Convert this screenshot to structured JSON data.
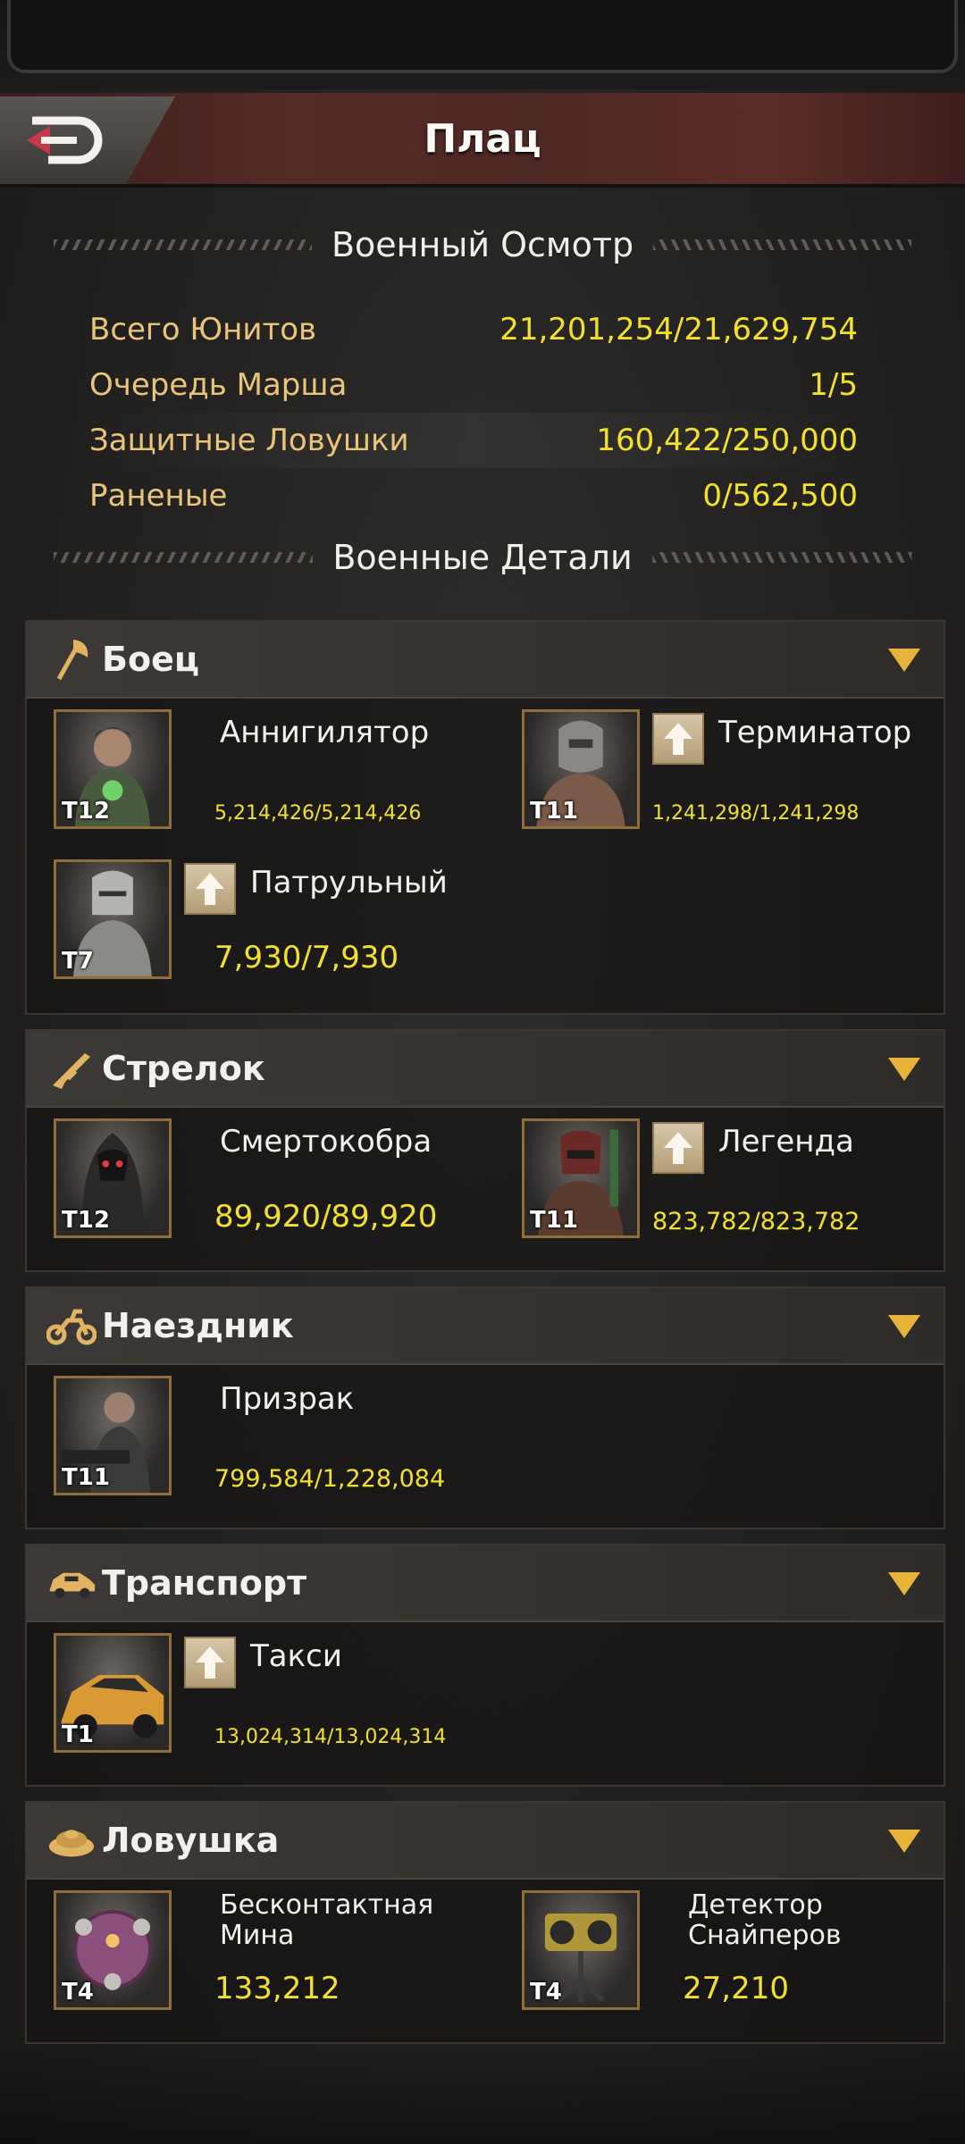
{
  "header": {
    "title": "Плац",
    "back_icon": "back-arrow-icon"
  },
  "inspection": {
    "title": "Военный Осмотр",
    "stats": [
      {
        "label": "Всего Юнитов",
        "value": "21,201,254/21,629,754"
      },
      {
        "label": "Очередь Марша",
        "value": "1/5"
      },
      {
        "label": "Защитные Ловушки",
        "value": "160,422/250,000"
      },
      {
        "label": "Раненые",
        "value": "0/562,500"
      }
    ]
  },
  "details": {
    "title": "Военные Детали"
  },
  "categories": [
    {
      "name": "Боец",
      "icon": "axe-icon",
      "units": [
        {
          "name": "Аннигилятор",
          "tier": "T12",
          "count": "5,214,426/5,214,426",
          "upgrade": false
        },
        {
          "name": "Терминатор",
          "tier": "T11",
          "count": "1,241,298/1,241,298",
          "upgrade": true
        },
        {
          "name": "Патрульный",
          "tier": "T7",
          "count": "7,930/7,930",
          "upgrade": true
        }
      ]
    },
    {
      "name": "Стрелок",
      "icon": "rifle-icon",
      "units": [
        {
          "name": "Смертокобра",
          "tier": "T12",
          "count": "89,920/89,920",
          "upgrade": false
        },
        {
          "name": "Легенда",
          "tier": "T11",
          "count": "823,782/823,782",
          "upgrade": true
        }
      ]
    },
    {
      "name": "Наездник",
      "icon": "motorcycle-icon",
      "units": [
        {
          "name": "Призрак",
          "tier": "T11",
          "count": "799,584/1,228,084",
          "upgrade": false
        }
      ]
    },
    {
      "name": "Транспорт",
      "icon": "car-icon",
      "units": [
        {
          "name": "Такси",
          "tier": "T1",
          "count": "13,024,314/13,024,314",
          "upgrade": true
        }
      ]
    },
    {
      "name": "Ловушка",
      "icon": "landmine-icon",
      "units": [
        {
          "name": "Бесконтактная Мина",
          "tier": "T4",
          "count": "133,212",
          "upgrade": false
        },
        {
          "name": "Детектор Снайперов",
          "tier": "T4",
          "count": "27,210",
          "upgrade": false
        }
      ]
    }
  ],
  "colors": {
    "gold_text": "#f2e12a",
    "label_text": "#e8c57a",
    "accent_arrow": "#e7b33a"
  }
}
